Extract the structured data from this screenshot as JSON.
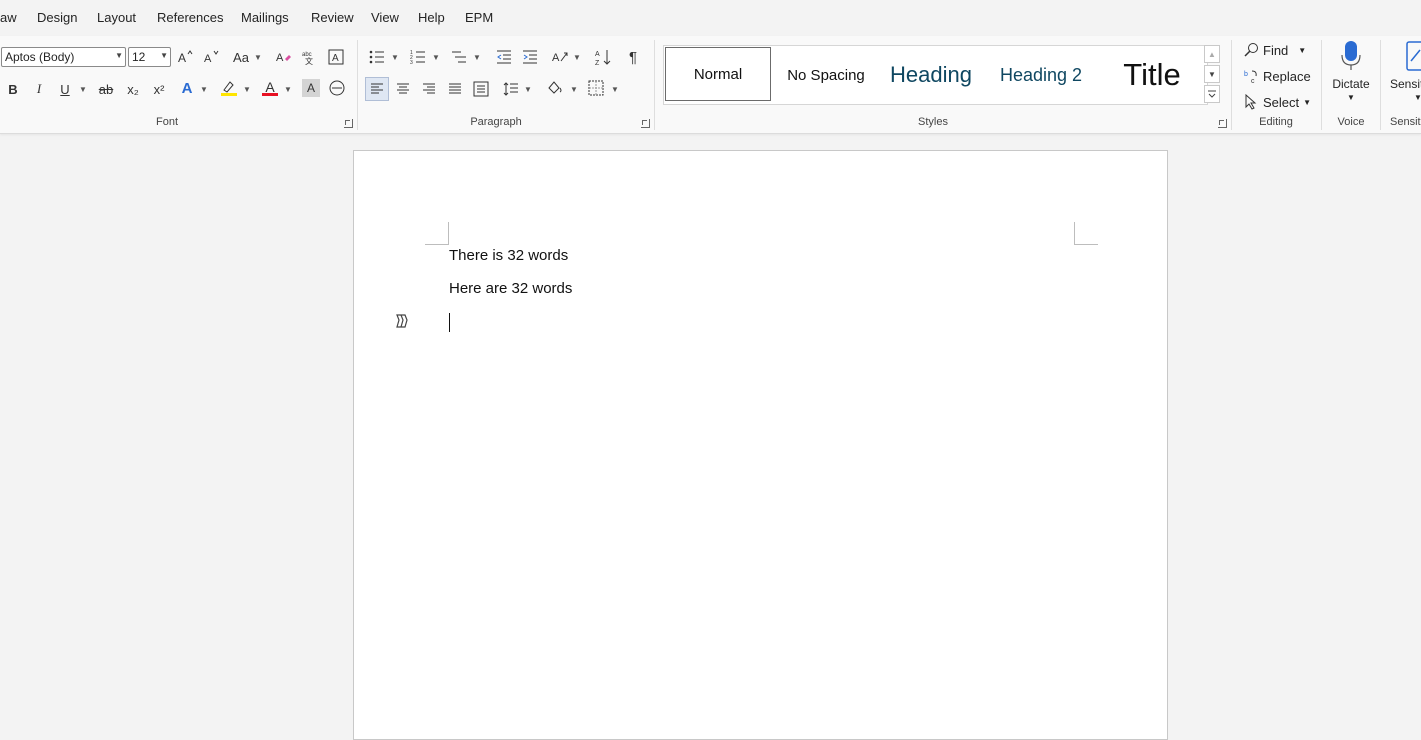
{
  "menu": {
    "tabs": [
      "aw",
      "Design",
      "Layout",
      "References",
      "Mailings",
      "Review",
      "View",
      "Help",
      "EPM"
    ]
  },
  "font": {
    "name": "Aptos (Body)",
    "size": "12",
    "group_label": "Font",
    "change_case": "Aa",
    "bold": "B",
    "italic": "I",
    "underline": "U",
    "strike": "ab",
    "subscript": "x₂",
    "superscript": "x²",
    "text_effects": "A",
    "font_color_glyph": "A",
    "shading_glyph": "A",
    "highlight_color": "#ffe500",
    "font_color": "#e81123"
  },
  "paragraph": {
    "group_label": "Paragraph",
    "pilcrow": "¶"
  },
  "styles": {
    "group_label": "Styles",
    "items": [
      "Normal",
      "No Spacing",
      "Heading",
      "Heading 2",
      "Title"
    ],
    "heading_color": "#0f4761"
  },
  "editing": {
    "group_label": "Editing",
    "find": "Find",
    "replace": "Replace",
    "select": "Select"
  },
  "voice": {
    "group_label": "Voice",
    "dictate": "Dictate"
  },
  "sensitivity": {
    "label": "Sensiti",
    "group_label": "Sensiti"
  },
  "document": {
    "lines": [
      "There is 32 words",
      "Here are 32 words"
    ]
  },
  "colors": {
    "accent": "#185abd"
  }
}
